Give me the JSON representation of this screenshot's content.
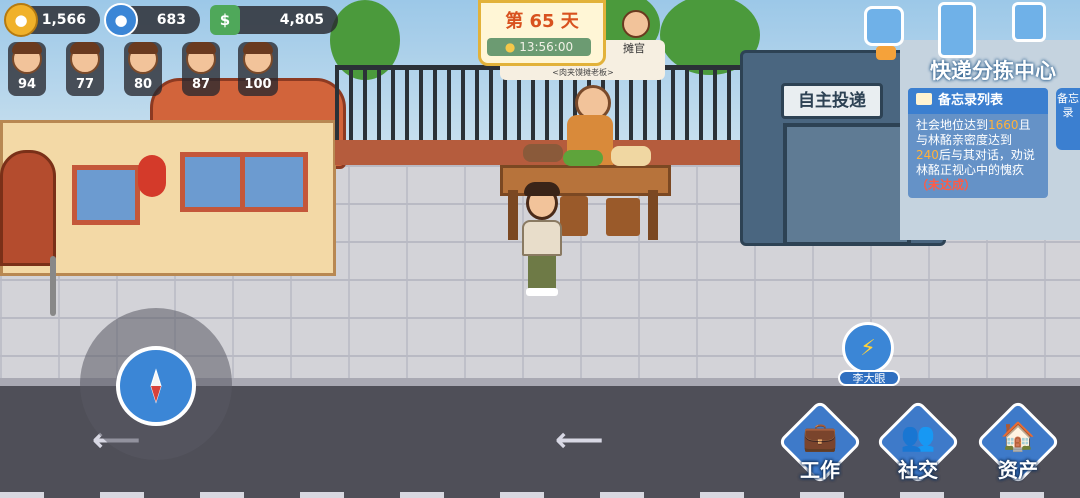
{
  "currencies": [
    {
      "icon": "gold-coin-icon",
      "glyph": "●",
      "color": "#f0b12a",
      "value": "1,566"
    },
    {
      "icon": "reputation-person-icon",
      "glyph": "●",
      "color": "#3b86d6",
      "value": "683"
    },
    {
      "icon": "cash-stack-icon",
      "glyph": "$",
      "color": "#4fa85a",
      "value": "4,805"
    }
  ],
  "relationships": [
    {
      "value": "94"
    },
    {
      "value": "77"
    },
    {
      "value": "80"
    },
    {
      "value": "87"
    },
    {
      "value": "100"
    }
  ],
  "day_panel": {
    "title": "第 65 天",
    "time": "13:56:00"
  },
  "stall": {
    "sign": "<肉夹馍摊老板>",
    "vendor_badge_label": "摊官"
  },
  "shop_sign": "自主投递",
  "express_center_sign": "快递分拣中心",
  "memo": {
    "title": "备忘录列表",
    "line1_a": "社会地位达到",
    "line1_value": "1660",
    "line1_b": "且",
    "line2": "与林酩亲密度达到",
    "line3_value": "240",
    "line3_b": "后与其对话，劝说",
    "line4": "林酩正视心中的愧疚",
    "status": "（未达成）",
    "side_tab": "备忘录"
  },
  "skill": {
    "label": "李大眼",
    "icon": "lightning-tap-icon"
  },
  "bottom_buttons": [
    {
      "label": "工作",
      "icon": "briefcase-icon",
      "glyph": "💼"
    },
    {
      "label": "社交",
      "icon": "people-icon",
      "glyph": "👥"
    },
    {
      "label": "资产",
      "icon": "house-icon",
      "glyph": "🏠"
    }
  ],
  "colors": {
    "accent": "#3b86d6",
    "highlight": "#ffb13b",
    "warning": "#ff5b45",
    "day_title": "#d8521f"
  }
}
